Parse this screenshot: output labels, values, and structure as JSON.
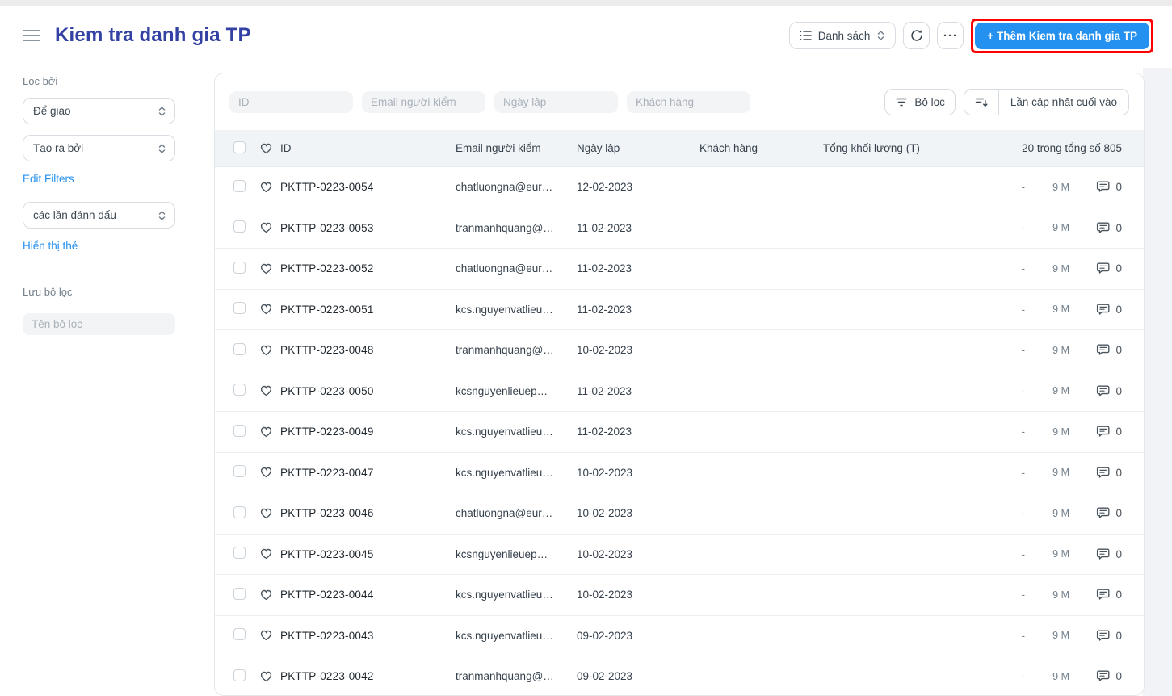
{
  "navbar": {
    "title": "Kiem tra danh gia TP",
    "view_switcher_label": "Danh sách",
    "menu_dots": "···",
    "primary_button_label": "+ Thêm Kiem tra danh gia TP"
  },
  "sidebar": {
    "filter_by_label": "Lọc bởi",
    "assigned_select": "Để giao",
    "created_by_select": "Tạo ra bởi",
    "edit_filters_link": "Edit Filters",
    "tags_select": "các lần đánh dấu",
    "show_tags_link": "Hiển thị thẻ",
    "save_filter_label": "Lưu bộ lọc",
    "filter_name_placeholder": "Tên bộ lọc"
  },
  "filter_bar": {
    "id_placeholder": "ID",
    "email_placeholder": "Email người kiểm",
    "date_placeholder": "Ngày lập",
    "customer_placeholder": "Khách hàng",
    "filter_button_label": "Bộ lọc",
    "sort_button_label": "Lần cập nhật cuối vào"
  },
  "table": {
    "headers": {
      "id": "ID",
      "email": "Email người kiểm",
      "date": "Ngày lập",
      "customer": "Khách hàng",
      "weight": "Tổng khối lượng (T)",
      "count": "20 trong tổng số 805"
    },
    "rows": [
      {
        "id": "PKTTP-0223-0054",
        "email": "chatluongna@eur…",
        "date": "12-02-2023",
        "customer": "",
        "weight": "-",
        "modified": "9 M",
        "comments": "0"
      },
      {
        "id": "PKTTP-0223-0053",
        "email": "tranmanhquang@…",
        "date": "11-02-2023",
        "customer": "",
        "weight": "-",
        "modified": "9 M",
        "comments": "0"
      },
      {
        "id": "PKTTP-0223-0052",
        "email": "chatluongna@eur…",
        "date": "11-02-2023",
        "customer": "",
        "weight": "-",
        "modified": "9 M",
        "comments": "0"
      },
      {
        "id": "PKTTP-0223-0051",
        "email": "kcs.nguyenvatlieu…",
        "date": "11-02-2023",
        "customer": "",
        "weight": "-",
        "modified": "9 M",
        "comments": "0"
      },
      {
        "id": "PKTTP-0223-0048",
        "email": "tranmanhquang@…",
        "date": "10-02-2023",
        "customer": "",
        "weight": "-",
        "modified": "9 M",
        "comments": "0"
      },
      {
        "id": "PKTTP-0223-0050",
        "email": "kcsnguyenlieuep…",
        "date": "11-02-2023",
        "customer": "",
        "weight": "-",
        "modified": "9 M",
        "comments": "0"
      },
      {
        "id": "PKTTP-0223-0049",
        "email": "kcs.nguyenvatlieu…",
        "date": "11-02-2023",
        "customer": "",
        "weight": "-",
        "modified": "9 M",
        "comments": "0"
      },
      {
        "id": "PKTTP-0223-0047",
        "email": "kcs.nguyenvatlieu…",
        "date": "10-02-2023",
        "customer": "",
        "weight": "-",
        "modified": "9 M",
        "comments": "0"
      },
      {
        "id": "PKTTP-0223-0046",
        "email": "chatluongna@eur…",
        "date": "10-02-2023",
        "customer": "",
        "weight": "-",
        "modified": "9 M",
        "comments": "0"
      },
      {
        "id": "PKTTP-0223-0045",
        "email": "kcsnguyenlieuep…",
        "date": "10-02-2023",
        "customer": "",
        "weight": "-",
        "modified": "9 M",
        "comments": "0"
      },
      {
        "id": "PKTTP-0223-0044",
        "email": "kcs.nguyenvatlieu…",
        "date": "10-02-2023",
        "customer": "",
        "weight": "-",
        "modified": "9 M",
        "comments": "0"
      },
      {
        "id": "PKTTP-0223-0043",
        "email": "kcs.nguyenvatlieu…",
        "date": "09-02-2023",
        "customer": "",
        "weight": "-",
        "modified": "9 M",
        "comments": "0"
      },
      {
        "id": "PKTTP-0223-0042",
        "email": "tranmanhquang@…",
        "date": "09-02-2023",
        "customer": "",
        "weight": "-",
        "modified": "9 M",
        "comments": "0"
      }
    ]
  },
  "colors": {
    "primary_blue": "#2490ef",
    "title_indigo": "#3241a3",
    "annotation_red": "#fb0200",
    "header_row_bg": "#f1f4f7",
    "muted_text": "#74808b"
  }
}
